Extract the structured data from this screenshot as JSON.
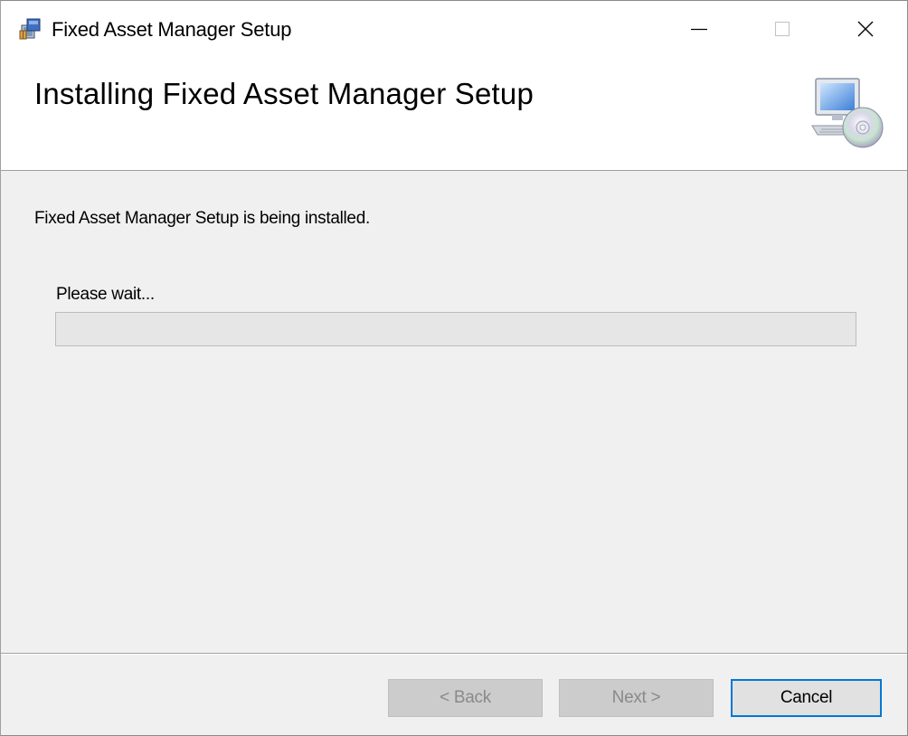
{
  "window": {
    "title": "Fixed Asset Manager Setup",
    "app_icon": "installer-package-icon",
    "controls": {
      "minimize_icon": "minimize-icon",
      "maximize_icon": "maximize-icon",
      "close_icon": "close-icon"
    }
  },
  "header": {
    "title": "Installing Fixed Asset Manager Setup",
    "icon": "computer-cd-icon"
  },
  "main": {
    "status_text": "Fixed Asset Manager Setup is being installed.",
    "wait_label": "Please wait...",
    "progress_fraction": 0
  },
  "footer": {
    "back_label": "< Back",
    "next_label": "Next >",
    "cancel_label": "Cancel"
  },
  "colors": {
    "focus_border": "#0078d7",
    "disabled_button": "#cccccc",
    "window_background": "#f0f0f0"
  }
}
